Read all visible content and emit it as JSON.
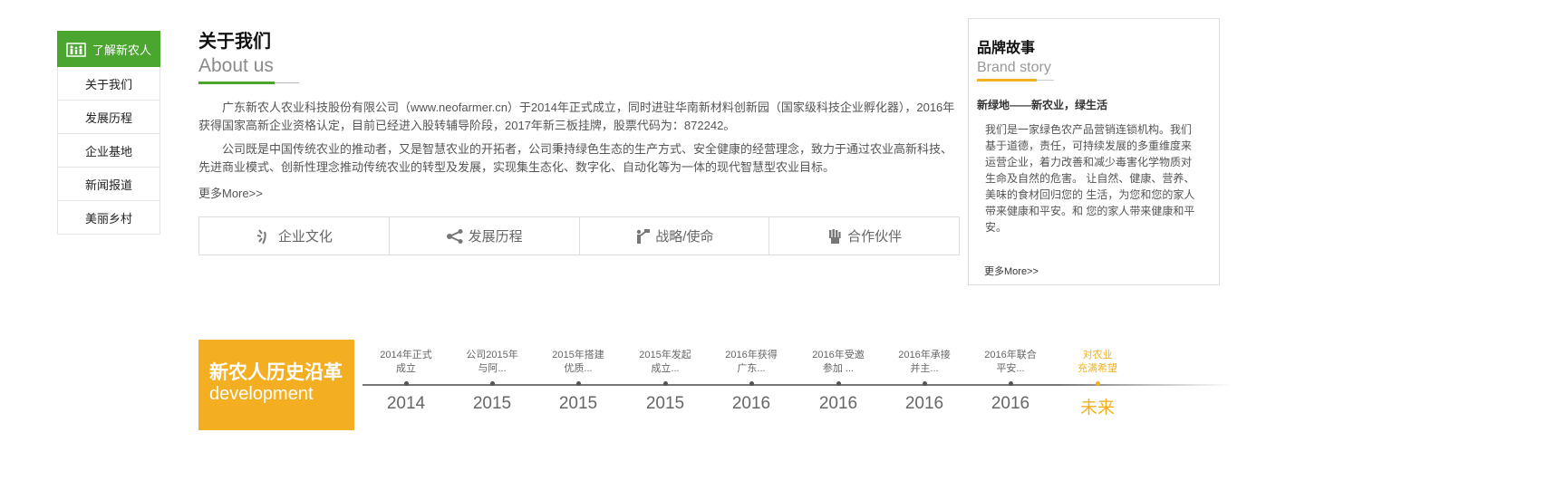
{
  "sidebar": {
    "header": "了解新农人",
    "items": [
      "关于我们",
      "发展历程",
      "企业基地",
      "新闻报道",
      "美丽乡村"
    ]
  },
  "about": {
    "title": "关于我们",
    "subtitle": "About us",
    "para1": "广东新农人农业科技股份有限公司（www.neofarmer.cn）于2014年正式成立，同时进驻华南新材料创新园（国家级科技企业孵化器），2016年获得国家高新企业资格认定，目前已经进入股转辅导阶段，2017年新三板挂牌，股票代码为：872242。",
    "para2": "公司既是中国传统农业的推动者，又是智慧农业的开拓者，公司秉持绿色生态的生产方式、安全健康的经营理念，致力于通过农业高新科技、先进商业模式、创新性理念推动传统农业的转型及发展，实现集生态化、数字化、自动化等为一体的现代智慧型农业目标。",
    "more": "更多More>>"
  },
  "tabs": [
    "企业文化",
    "发展历程",
    "战略/使命",
    "合作伙伴"
  ],
  "brand": {
    "title": "品牌故事",
    "subtitle": "Brand story",
    "slogan": "新绿地——新农业，绿生活",
    "text": "我们是一家绿色农产品营销连锁机构。我们 基于道德，责任，可持续发展的多重维度来 运营企业，着力改善和减少毒害化学物质对 生命及自然的危害。 让自然、健康、营养、美味的食材回归您的 生活，为您和您的家人带来健康和平安。和 您的家人带来健康和平安。",
    "more": "更多More>>"
  },
  "timeline": {
    "title_cn": "新农人历史沿革",
    "title_en": "development",
    "items": [
      {
        "text1": "2014年正式",
        "text2": "成立",
        "year": "2014"
      },
      {
        "text1": "公司2015年",
        "text2": "与阿...",
        "year": "2015"
      },
      {
        "text1": "2015年搭建",
        "text2": "优质...",
        "year": "2015"
      },
      {
        "text1": "2015年发起",
        "text2": "成立...",
        "year": "2015"
      },
      {
        "text1": "2016年获得",
        "text2": "广东...",
        "year": "2016"
      },
      {
        "text1": "2016年受邀",
        "text2": "参加 ...",
        "year": "2016"
      },
      {
        "text1": "2016年承接",
        "text2": "并主...",
        "year": "2016"
      },
      {
        "text1": "2016年联合",
        "text2": "平安...",
        "year": "2016"
      },
      {
        "text1": "对农业",
        "text2": "充满希望",
        "year": "未来"
      }
    ]
  },
  "colors": {
    "green": "#4aa62f",
    "orange": "#f4ae22",
    "gold": "#f2b01e"
  }
}
